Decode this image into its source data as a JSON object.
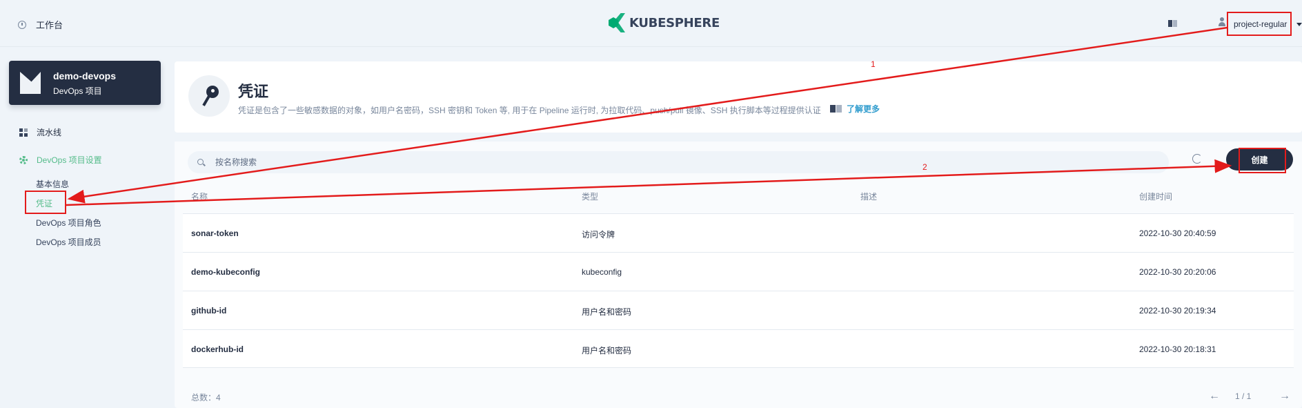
{
  "topbar": {
    "workbench_label": "工作台",
    "logo_text": "KUBESPHERE",
    "username": "project-regular"
  },
  "sidebar": {
    "project_name": "demo-devops",
    "project_type": "DevOps 项目",
    "pipelines_label": "流水线",
    "settings_label": "DevOps 项目设置",
    "settings_items": [
      {
        "label": "基本信息"
      },
      {
        "label": "凭证"
      },
      {
        "label": "DevOps 项目角色"
      },
      {
        "label": "DevOps 项目成员"
      }
    ]
  },
  "header": {
    "title": "凭证",
    "description": "凭证是包含了一些敏感数据的对象，如用户名密码，SSH 密钥和 Token 等, 用于在 Pipeline 运行时, 为拉取代码、push/pull 镜像、SSH 执行脚本等过程提供认证",
    "learn_more": "了解更多"
  },
  "toolbar": {
    "search_placeholder": "按名称搜索",
    "create_label": "创建"
  },
  "table": {
    "columns": [
      "名称",
      "类型",
      "描述",
      "创建时间"
    ],
    "rows": [
      {
        "name": "sonar-token",
        "type": "访问令牌",
        "description": "",
        "created": "2022-10-30 20:40:59"
      },
      {
        "name": "demo-kubeconfig",
        "type": "kubeconfig",
        "description": "",
        "created": "2022-10-30 20:20:06"
      },
      {
        "name": "github-id",
        "type": "用户名和密码",
        "description": "",
        "created": "2022-10-30 20:19:34"
      },
      {
        "name": "dockerhub-id",
        "type": "用户名和密码",
        "description": "",
        "created": "2022-10-30 20:18:31"
      }
    ]
  },
  "footer": {
    "total": "总数：4",
    "prev_icon": "←",
    "pages": "1 / 1",
    "next_icon": "→"
  },
  "annotations": {
    "label_1": "1",
    "label_2": "2",
    "color": "#e31b1b"
  }
}
